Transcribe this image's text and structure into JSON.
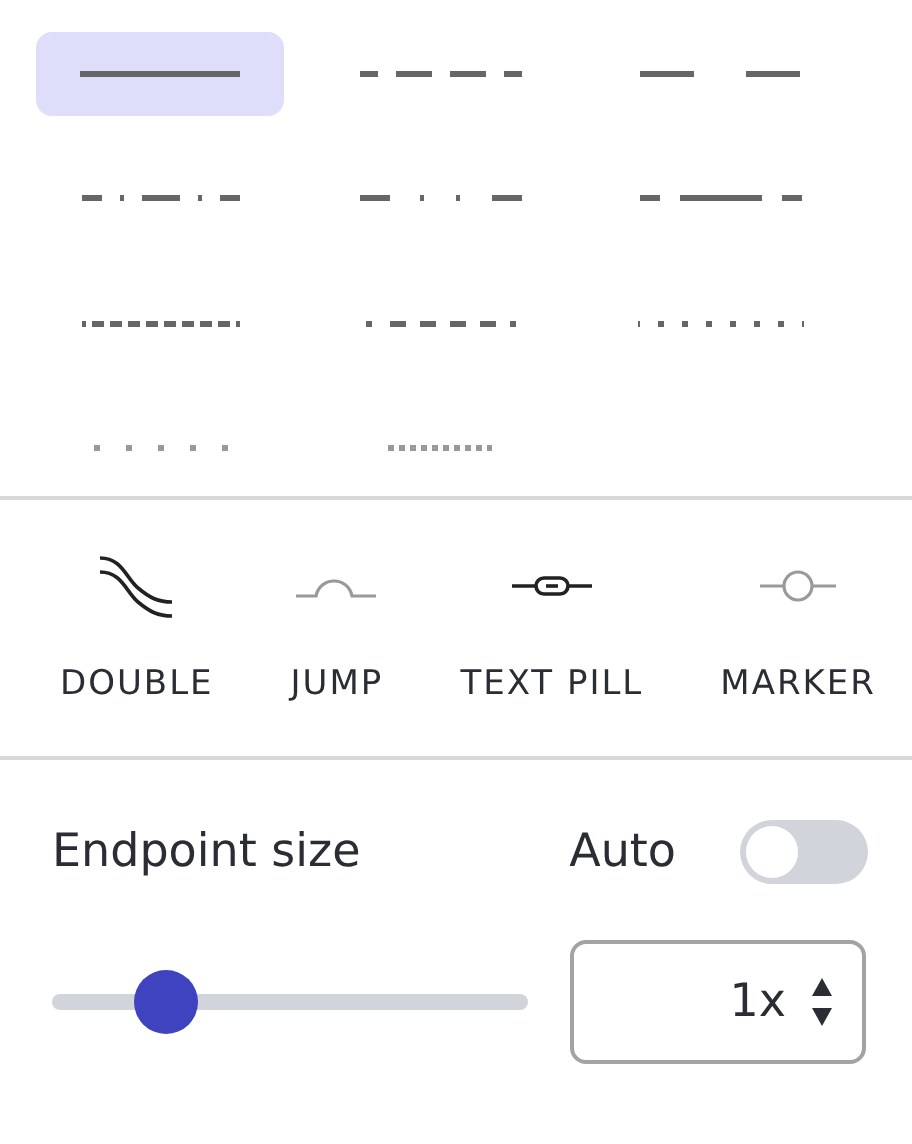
{
  "line_styles": [
    {
      "kind": "solid",
      "selected": true
    },
    {
      "kind": "dashed",
      "selected": false
    },
    {
      "kind": "long-gap",
      "selected": false
    },
    {
      "kind": "dash-dot",
      "selected": false
    },
    {
      "kind": "dash-dot-dot",
      "selected": false
    },
    {
      "kind": "short-long",
      "selected": false
    },
    {
      "kind": "dense-dash",
      "selected": false
    },
    {
      "kind": "dot-dash",
      "selected": false
    },
    {
      "kind": "sparse-dot",
      "selected": false
    },
    {
      "kind": "wide-dot",
      "selected": false
    },
    {
      "kind": "fine-dot",
      "selected": false
    }
  ],
  "connector_styles": [
    {
      "kind": "double",
      "label": "DOUBLE"
    },
    {
      "kind": "jump",
      "label": "JUMP"
    },
    {
      "kind": "text-pill",
      "label": "TEXT PILL"
    },
    {
      "kind": "marker",
      "label": "MARKER"
    }
  ],
  "endpoint": {
    "label": "Endpoint size",
    "auto_label": "Auto",
    "auto_on": false,
    "level": 0.24,
    "value": "1x"
  }
}
